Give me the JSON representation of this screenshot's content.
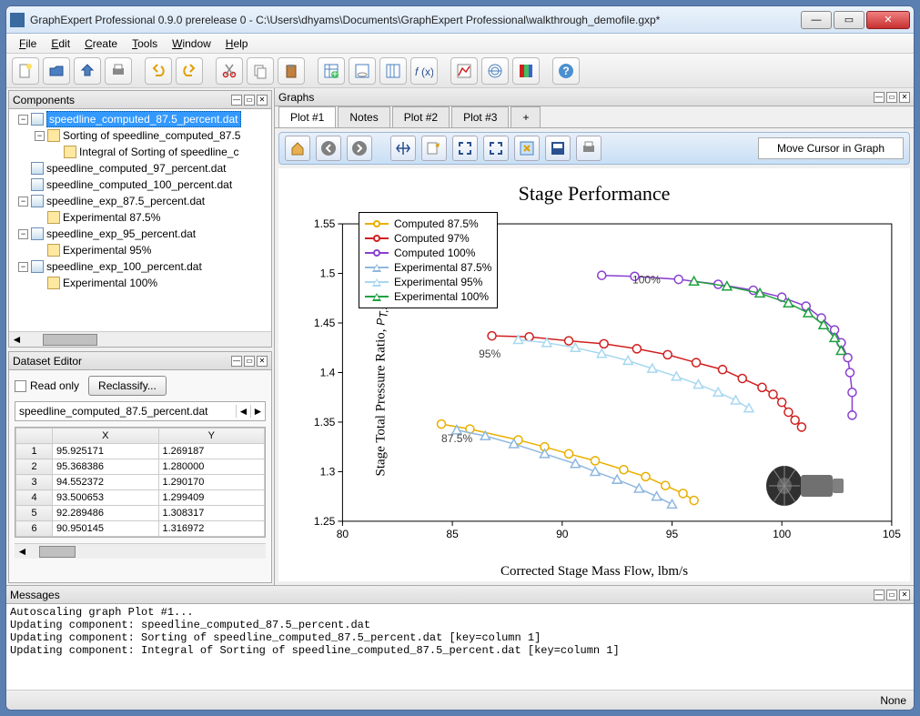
{
  "window": {
    "title": "GraphExpert Professional 0.9.0 prerelease 0 - C:\\Users\\dhyams\\Documents\\GraphExpert Professional\\walkthrough_demofile.gxp*"
  },
  "menu": [
    "File",
    "Edit",
    "Create",
    "Tools",
    "Window",
    "Help"
  ],
  "panels": {
    "components_title": "Components",
    "dataset_title": "Dataset Editor",
    "graphs_title": "Graphs",
    "messages_title": "Messages"
  },
  "tree": {
    "items": [
      {
        "indent": 0,
        "expanded": true,
        "label": "speedline_computed_87.5_percent.dat",
        "icon": "data",
        "selected": true
      },
      {
        "indent": 1,
        "expanded": true,
        "label": "Sorting of speedline_computed_87.5",
        "icon": "result"
      },
      {
        "indent": 2,
        "expanded": null,
        "label": "Integral of Sorting of speedline_c",
        "icon": "result"
      },
      {
        "indent": 0,
        "expanded": null,
        "label": "speedline_computed_97_percent.dat",
        "icon": "data"
      },
      {
        "indent": 0,
        "expanded": null,
        "label": "speedline_computed_100_percent.dat",
        "icon": "data"
      },
      {
        "indent": 0,
        "expanded": true,
        "label": "speedline_exp_87.5_percent.dat",
        "icon": "data"
      },
      {
        "indent": 1,
        "expanded": null,
        "label": "Experimental 87.5%",
        "icon": "result"
      },
      {
        "indent": 0,
        "expanded": true,
        "label": "speedline_exp_95_percent.dat",
        "icon": "data"
      },
      {
        "indent": 1,
        "expanded": null,
        "label": "Experimental 95%",
        "icon": "result"
      },
      {
        "indent": 0,
        "expanded": true,
        "label": "speedline_exp_100_percent.dat",
        "icon": "data"
      },
      {
        "indent": 1,
        "expanded": null,
        "label": "Experimental 100%",
        "icon": "result"
      }
    ]
  },
  "dataset": {
    "read_only_label": "Read only",
    "reclassify_label": "Reclassify...",
    "sheet_name": "speedline_computed_87.5_percent.dat",
    "columns": [
      "X",
      "Y"
    ],
    "rows": [
      {
        "n": "1",
        "x": "95.925171",
        "y": "1.269187"
      },
      {
        "n": "2",
        "x": "95.368386",
        "y": "1.280000"
      },
      {
        "n": "3",
        "x": "94.552372",
        "y": "1.290170"
      },
      {
        "n": "4",
        "x": "93.500653",
        "y": "1.299409"
      },
      {
        "n": "5",
        "x": "92.289486",
        "y": "1.308317"
      },
      {
        "n": "6",
        "x": "90.950145",
        "y": "1.316972"
      }
    ]
  },
  "graph_tabs": [
    "Plot #1",
    "Notes",
    "Plot #2",
    "Plot #3",
    "+"
  ],
  "graph_toolbar": {
    "cursor_hint": "Move Cursor in Graph"
  },
  "messages": [
    "Autoscaling graph Plot #1...",
    "Updating component: speedline_computed_87.5_percent.dat",
    "Updating component: Sorting of speedline_computed_87.5_percent.dat [key=column 1]",
    "Updating component: Integral of Sorting of speedline_computed_87.5_percent.dat [key=column 1]"
  ],
  "statusbar": {
    "right": "None"
  },
  "chart_data": {
    "type": "line",
    "title": "Stage Performance",
    "xlabel": "Corrected Stage Mass Flow, lbm/s",
    "ylabel": "Stage Total Pressure Ratio, P_T,st / P_T,∞",
    "xlim": [
      80,
      105
    ],
    "ylim": [
      1.25,
      1.55
    ],
    "xt": [
      80,
      85,
      90,
      95,
      100,
      105
    ],
    "yt": [
      1.25,
      1.3,
      1.35,
      1.4,
      1.45,
      1.5,
      1.55
    ],
    "annotations": [
      {
        "text": "87.5%",
        "x": 84.5,
        "y": 1.33
      },
      {
        "text": "95%",
        "x": 86.2,
        "y": 1.415
      },
      {
        "text": "100%",
        "x": 93.2,
        "y": 1.49
      }
    ],
    "series": [
      {
        "name": "Computed 87.5%",
        "marker": "circle",
        "color": "#e8b000",
        "x": [
          84.5,
          85.8,
          88.0,
          89.2,
          90.3,
          91.5,
          92.8,
          93.8,
          94.7,
          95.5,
          96.0
        ],
        "y": [
          1.348,
          1.343,
          1.332,
          1.325,
          1.318,
          1.311,
          1.302,
          1.295,
          1.286,
          1.278,
          1.271
        ]
      },
      {
        "name": "Computed 97%",
        "marker": "circle",
        "color": "#d02020",
        "x": [
          86.8,
          88.5,
          90.3,
          91.9,
          93.4,
          94.8,
          96.1,
          97.3,
          98.2,
          99.1,
          99.6,
          100.0,
          100.3,
          100.6,
          100.9
        ],
        "y": [
          1.437,
          1.436,
          1.432,
          1.429,
          1.424,
          1.418,
          1.41,
          1.403,
          1.394,
          1.385,
          1.378,
          1.37,
          1.36,
          1.352,
          1.345
        ]
      },
      {
        "name": "Computed 100%",
        "marker": "circle",
        "color": "#8a40d0",
        "x": [
          91.8,
          93.3,
          95.3,
          97.1,
          98.7,
          100.0,
          101.1,
          101.8,
          102.4,
          102.7,
          103.0,
          103.1,
          103.2,
          103.2
        ],
        "y": [
          1.498,
          1.497,
          1.494,
          1.489,
          1.483,
          1.476,
          1.467,
          1.455,
          1.443,
          1.43,
          1.415,
          1.4,
          1.38,
          1.357
        ]
      },
      {
        "name": "Experimental 87.5%",
        "marker": "triangle",
        "color": "#8fb8e0",
        "x": [
          85.2,
          86.5,
          87.8,
          89.2,
          90.6,
          91.5,
          92.5,
          93.5,
          94.3,
          95.0
        ],
        "y": [
          1.342,
          1.336,
          1.328,
          1.318,
          1.308,
          1.3,
          1.292,
          1.283,
          1.275,
          1.267
        ]
      },
      {
        "name": "Experimental 95%",
        "marker": "triangle",
        "color": "#a8d8f0",
        "x": [
          88.0,
          89.3,
          90.6,
          91.8,
          93.0,
          94.1,
          95.2,
          96.2,
          97.1,
          97.9,
          98.5
        ],
        "y": [
          1.433,
          1.43,
          1.425,
          1.419,
          1.412,
          1.404,
          1.396,
          1.388,
          1.38,
          1.372,
          1.364
        ]
      },
      {
        "name": "Experimental 100%",
        "marker": "triangle",
        "color": "#20a040",
        "x": [
          96.0,
          97.5,
          99.0,
          100.3,
          101.2,
          101.9,
          102.4,
          102.7
        ],
        "y": [
          1.492,
          1.487,
          1.48,
          1.47,
          1.46,
          1.448,
          1.435,
          1.422
        ]
      }
    ]
  }
}
